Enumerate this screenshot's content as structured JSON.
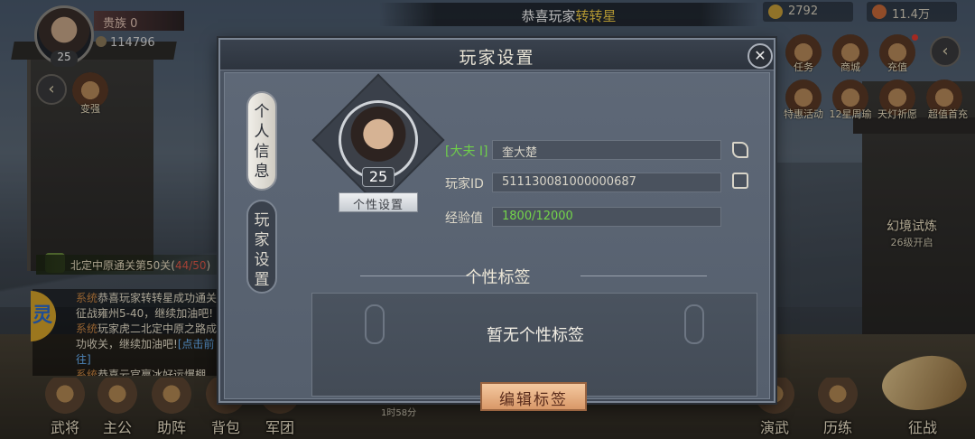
{
  "hud": {
    "player_level": "25",
    "rank_label": "贵族 0",
    "power": "114796",
    "marquee_prefix": "恭喜玩家",
    "marquee_highlight": "转转星",
    "resource_a": "2792",
    "resource_b": "11.4万"
  },
  "side_buttons": {
    "strengthen": "变强",
    "right": [
      "任务",
      "商城",
      "充值",
      "特惠活动",
      "12星周瑜",
      "天灯祈愿",
      "超值首充"
    ]
  },
  "trial": {
    "title": "幻境试炼",
    "subtitle": "26级开启"
  },
  "quest": {
    "text": "北定中原通关第50关(",
    "count": "44/50",
    "close": ")"
  },
  "chat": {
    "badge": "灵",
    "lines": [
      {
        "tag": "系统",
        "text": "恭喜玩家转转星成功通关征战雍州5-40，继续加油吧!"
      },
      {
        "tag": "系统",
        "text": "玩家虎二北定中原之路成功收关，继续加油吧!",
        "link": "[点击前往]"
      },
      {
        "tag": "系统",
        "text": "恭喜云官赢冰好运爆棚，在聚"
      }
    ]
  },
  "bottom_menu": [
    "武将",
    "主公",
    "助阵",
    "背包",
    "军团",
    "演武",
    "历练",
    "征战"
  ],
  "timer": "1时58分",
  "dialog": {
    "title": "玩家设置",
    "close_symbol": "✕",
    "tab_personal": [
      "个",
      "人",
      "信",
      "息"
    ],
    "tab_player": [
      "玩",
      "家",
      "设",
      "置"
    ],
    "avatar_level": "25",
    "persona_button": "个性设置",
    "title_tag": "[大夫 I]",
    "player_name": "奎大楚",
    "id_label": "玩家ID",
    "id_value": "511130081000000687",
    "exp_label": "经验值",
    "exp_value": "1800/12000",
    "section_title": "个性标签",
    "empty_tags": "暂无个性标签",
    "edit_button": "编辑标签"
  },
  "icons": {
    "close": "close-icon",
    "edit_name": "quill-icon",
    "copy_id": "copy-icon",
    "back": "arrow-left-icon"
  }
}
